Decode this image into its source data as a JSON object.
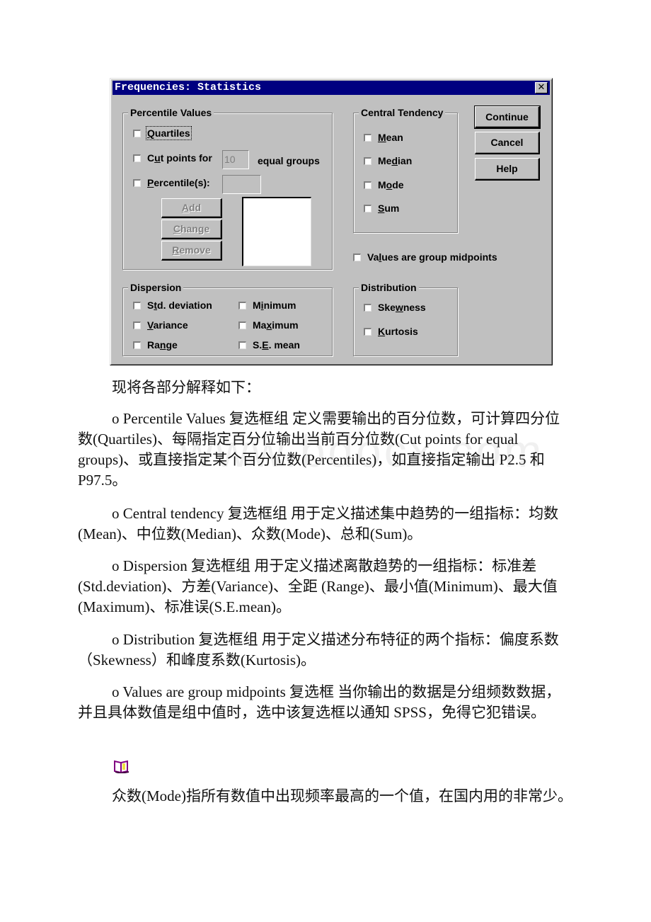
{
  "dialog": {
    "title": "Frequencies: Statistics",
    "close_icon": "close-x-icon",
    "percentile_values": {
      "label": "Percentile Values",
      "quartiles": {
        "pre": "",
        "key": "Q",
        "post": "uartiles",
        "checked": false
      },
      "cut_points": {
        "pre": "C",
        "key": "u",
        "post": "t points for",
        "checked": false,
        "value": "10",
        "suffix": "equal groups"
      },
      "percentiles": {
        "pre": "",
        "key": "P",
        "post": "ercentile(s):",
        "checked": false,
        "value": ""
      },
      "buttons": {
        "add": {
          "pre": "",
          "key": "A",
          "post": "dd"
        },
        "change": {
          "pre": "",
          "key": "C",
          "post": "hange"
        },
        "remove": {
          "pre": "",
          "key": "R",
          "post": "emove"
        }
      }
    },
    "central_tendency": {
      "label": "Central Tendency",
      "items": [
        {
          "pre": "",
          "key": "M",
          "post": "ean",
          "checked": false
        },
        {
          "pre": "Me",
          "key": "d",
          "post": "ian",
          "checked": false
        },
        {
          "pre": "M",
          "key": "o",
          "post": "de",
          "checked": false
        },
        {
          "pre": "",
          "key": "S",
          "post": "um",
          "checked": false
        }
      ]
    },
    "buttons": {
      "continue": "Continue",
      "cancel": "Cancel",
      "help": "Help"
    },
    "group_midpoints": {
      "pre": "Va",
      "key": "l",
      "post": "ues are group midpoints",
      "checked": false
    },
    "dispersion": {
      "label": "Dispersion",
      "items": [
        {
          "pre": "S",
          "key": "t",
          "post": "d. deviation",
          "checked": false
        },
        {
          "pre": "M",
          "key": "i",
          "post": "nimum",
          "checked": false
        },
        {
          "pre": "",
          "key": "V",
          "post": "ariance",
          "checked": false
        },
        {
          "pre": "Ma",
          "key": "x",
          "post": "imum",
          "checked": false
        },
        {
          "pre": "Ra",
          "key": "n",
          "post": "ge",
          "checked": false
        },
        {
          "pre": "S.",
          "key": "E",
          "post": ". mean",
          "checked": false
        }
      ]
    },
    "distribution": {
      "label": "Distribution",
      "items": [
        {
          "pre": "Ske",
          "key": "w",
          "post": "ness",
          "checked": false
        },
        {
          "pre": "",
          "key": "K",
          "post": "urtosis",
          "checked": false
        }
      ]
    }
  },
  "document": {
    "intro": "现将各部分解释如下：",
    "paragraphs": [
      "o Percentile Values 复选框组 定义需要输出的百分位数，可计算四分位数(Quartiles)、每隔指定百分位输出当前百分位数(Cut points for   equal groups)、或直接指定某个百分位数(Percentiles)，如直接指定输出 P2.5 和 P97.5。",
      "o Central tendency 复选框组 用于定义描述集中趋势的一组指标：均数(Mean)、中位数(Median)、众数(Mode)、总和(Sum)。",
      "o Dispersion 复选框组 用于定义描述离散趋势的一组指标：标准差(Std.deviation)、方差(Variance)、全距 (Range)、最小值(Minimum)、最大值(Maximum)、标准误(S.E.mean)。",
      "o Distribution 复选框组 用于定义描述分布特征的两个指标：偏度系数（Skewness）和峰度系数(Kurtosis)。",
      "o Values are group midpoints 复选框 当你输出的数据是分组频数数据，并且具体数值是组中值时，选中该复选框以通知 SPSS，免得它犯错误。"
    ],
    "note_icon": "book-icon",
    "note": "众数(Mode)指所有数值中出现频率最高的一个值，在国内用的非常少。",
    "watermark": "www.bdocx.com"
  }
}
